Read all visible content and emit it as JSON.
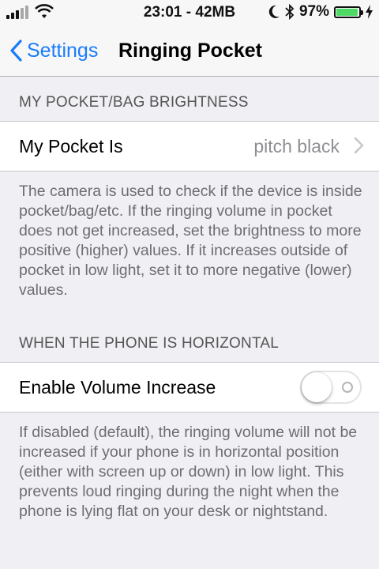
{
  "status": {
    "time_memory": "23:01 - 42MB",
    "battery": "97%",
    "battery_level": 0.97,
    "icons": [
      "signal-icon",
      "wifi-icon",
      "moon-icon",
      "bluetooth-icon",
      "battery-icon",
      "charging-icon"
    ]
  },
  "nav": {
    "back_label": "Settings",
    "title": "Ringing Pocket"
  },
  "section1": {
    "header": "MY POCKET/BAG BRIGHTNESS",
    "cell_label": "My Pocket Is",
    "cell_value": "pitch black",
    "footer": "The camera is used to check if the device is inside pocket/bag/etc. If the ringing volume in pocket does not get increased, set the brightness to more positive (higher) values. If it increases outside of pocket in low light, set it to more negative (lower) values."
  },
  "section2": {
    "header": "WHEN THE PHONE IS HORIZONTAL",
    "cell_label": "Enable Volume Increase",
    "toggle_on": false,
    "footer": "If disabled (default), the ringing volume will not be increased if your phone is in horizontal position (either with screen up or down) in low light. This prevents loud ringing during the night when the phone is lying flat on your desk or nightstand."
  },
  "colors": {
    "accent": "#1a7dfa",
    "background": "#efeff4",
    "battery_fill": "#4cd964"
  }
}
